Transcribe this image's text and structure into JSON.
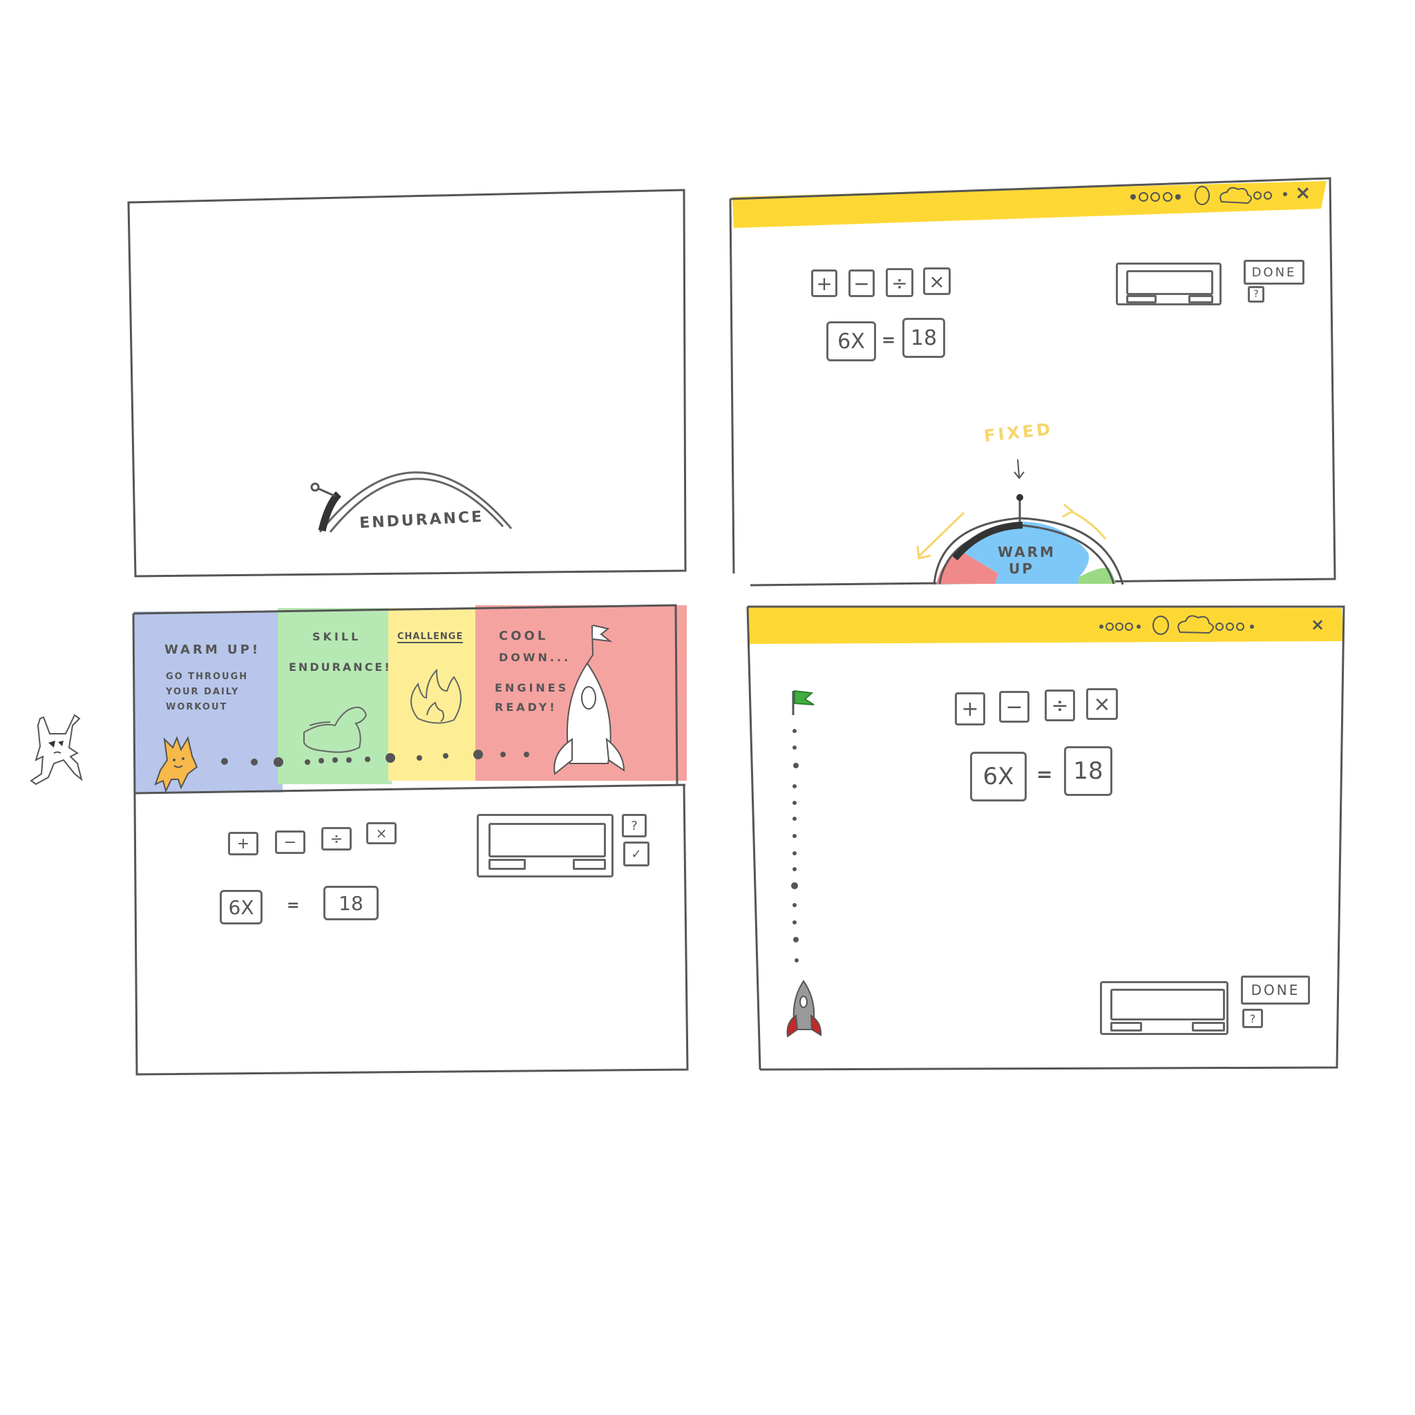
{
  "panel1": {
    "gauge_label": "ENDURANCE",
    "progress_fill": 0.08
  },
  "panel2": {
    "titlebar_close": "×",
    "operators": [
      "+",
      "−",
      "÷",
      "×"
    ],
    "equation": {
      "left": "6X",
      "equals": "=",
      "right": "18"
    },
    "done_label": "DONE",
    "help_label": "?",
    "annotation": "FIXED",
    "wheel_label_line1": "WARM",
    "wheel_label_line2": "UP",
    "colors": {
      "title_bar": "#FDD835",
      "warm_up": "#7EC8F8",
      "cool_down": "#F08A8A",
      "skill": "#9ADA84",
      "arrow": "#F6D66B"
    }
  },
  "panel3": {
    "stages": [
      {
        "title": "WARM UP!",
        "body": [
          "GO THROUGH",
          "YOUR DAILY",
          "WORKOUT"
        ],
        "color": "#B7C6EA"
      },
      {
        "title": "SKILL",
        "body": [
          "ENDURANCE!"
        ],
        "color": "#B6E8B4"
      },
      {
        "title": "CHALLENGE",
        "body": [],
        "color": "#FDEE96"
      },
      {
        "title": "COOL",
        "body": [
          "DOWN...",
          "ENGINES",
          "READY!"
        ],
        "color": "#F5A3A1"
      }
    ],
    "operators": [
      "+",
      "−",
      "÷",
      "×"
    ],
    "equation": {
      "left": "6X",
      "equals": "=",
      "right": "18"
    },
    "help_label": "?",
    "check_label": "✓"
  },
  "panel4": {
    "titlebar_close": "×",
    "operators": [
      "+",
      "−",
      "÷",
      "×"
    ],
    "equation": {
      "left": "6X",
      "equals": "=",
      "right": "18"
    },
    "done_label": "DONE",
    "help_label": "?",
    "progress_fill": 0.0
  },
  "icons": {
    "mascot_outside": "mascot-icon",
    "mascot_warmup": "orange-mascot-icon",
    "flexed_arm": "flexed-arm-icon",
    "flame": "flame-icon",
    "rocket": "rocket-icon",
    "flag": "flag-icon"
  }
}
